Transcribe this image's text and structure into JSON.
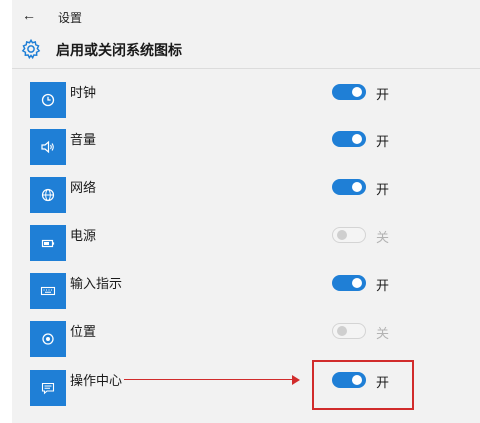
{
  "app": {
    "title": "设置",
    "back_icon": "back-arrow-icon"
  },
  "header": {
    "title": "启用或关闭系统图标",
    "icon": "gear-icon"
  },
  "accent": "#1f7fd6",
  "items": [
    {
      "label": "时钟",
      "icon": "clock-icon",
      "on": true,
      "state": "开"
    },
    {
      "label": "音量",
      "icon": "volume-icon",
      "on": true,
      "state": "开"
    },
    {
      "label": "网络",
      "icon": "globe-icon",
      "on": true,
      "state": "开"
    },
    {
      "label": "电源",
      "icon": "battery-icon",
      "on": false,
      "state": "关"
    },
    {
      "label": "输入指示",
      "icon": "keyboard-icon",
      "on": true,
      "state": "开"
    },
    {
      "label": "位置",
      "icon": "location-icon",
      "on": false,
      "state": "关"
    },
    {
      "label": "操作中心",
      "icon": "action-center-icon",
      "on": true,
      "state": "开"
    }
  ],
  "annotation": {
    "color": "#d12c2c",
    "target": "操作中心"
  }
}
